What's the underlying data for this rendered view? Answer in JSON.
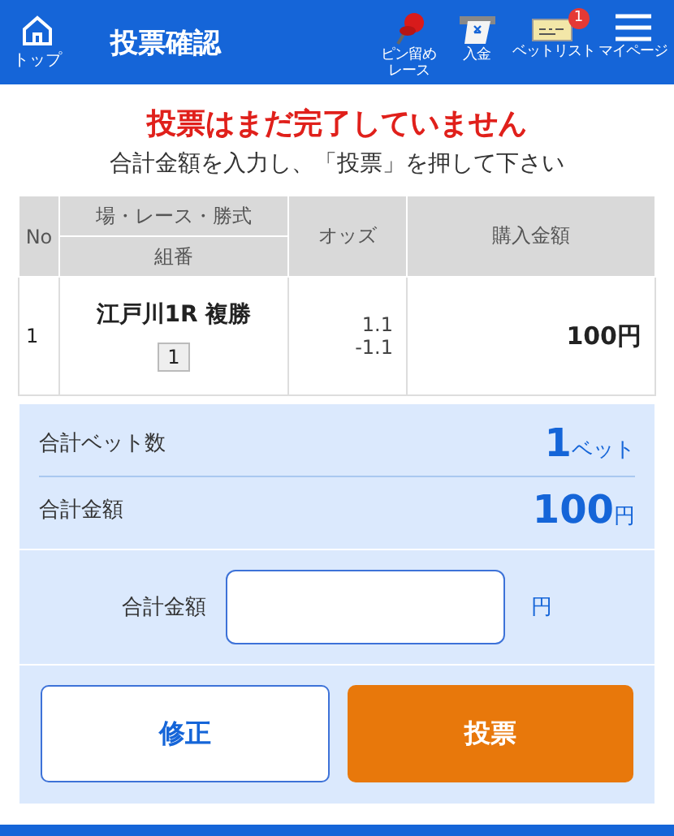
{
  "header": {
    "home_label": "トップ",
    "title": "投票確認",
    "nav": [
      {
        "kind": "pin",
        "label": "ピン留めレース"
      },
      {
        "kind": "deposit",
        "label": "入金"
      },
      {
        "kind": "betlist",
        "label": "ベットリスト",
        "badge": "1"
      },
      {
        "kind": "menu",
        "label": "マイページ"
      }
    ]
  },
  "message": {
    "title": "投票はまだ完了していません",
    "subtitle": "合計金額を入力し、「投票」を押して下さい"
  },
  "table": {
    "columns": {
      "no": "No",
      "race": "場・レース・勝式",
      "combo": "組番",
      "odds": "オッズ",
      "amount": "購入金額"
    },
    "rows": [
      {
        "no": "1",
        "race": "江戸川1R 複勝",
        "combo": [
          "1"
        ],
        "odds": "1.1\n-1.1",
        "amount": "100円"
      }
    ]
  },
  "summary": [
    {
      "label": "合計ベット数",
      "value": "1",
      "unit": "ベット"
    },
    {
      "label": "合計金額",
      "value": "100",
      "unit": "円"
    }
  ],
  "amount_input": {
    "label": "合計金額",
    "unit": "円"
  },
  "buttons": [
    {
      "kind": "secondary",
      "label": "修正"
    },
    {
      "kind": "primary",
      "label": "投票"
    }
  ]
}
